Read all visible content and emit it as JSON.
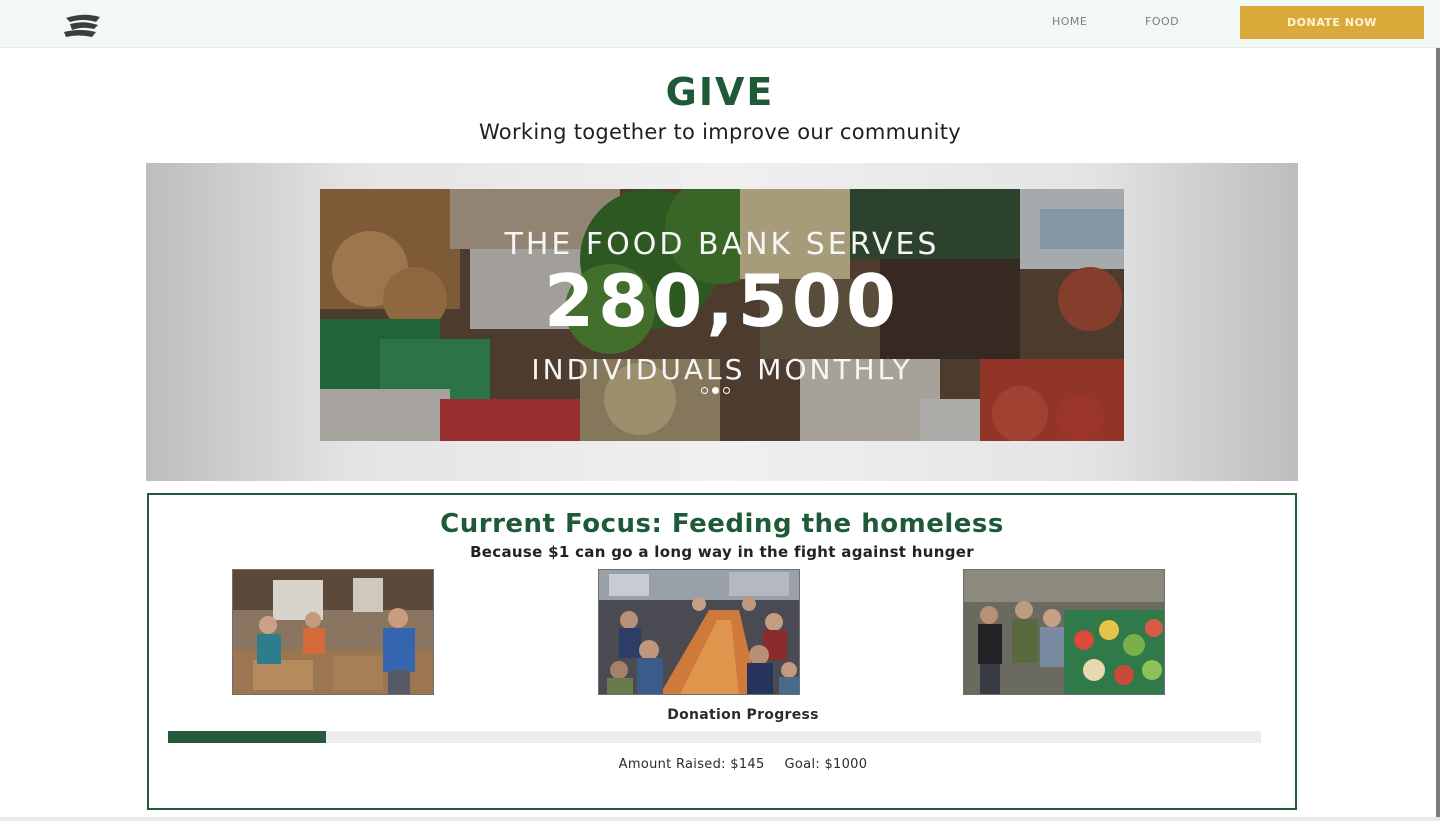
{
  "nav": {
    "logo_icon": "swirl-logo-icon",
    "links": [
      "HOME",
      "FOOD"
    ],
    "donate_label": "DONATE NOW"
  },
  "header": {
    "title": "GIVE",
    "subtitle": "Working together to improve our community"
  },
  "carousel": {
    "line1": "THE FOOD BANK SERVES",
    "number": "280,500",
    "line3": "INDIVIDUALS MONTHLY",
    "slide_count": 3,
    "active_slide": 1
  },
  "focus": {
    "title": "Current Focus: Feeding the homeless",
    "subtitle": "Because $1 can go a long way in the fight against hunger",
    "photos": [
      "volunteers-food-drive-photo",
      "community-meal-photo",
      "produce-distribution-photo"
    ],
    "progress_label": "Donation Progress",
    "raised_text": "Amount Raised: $145",
    "goal_text": "Goal: $1000",
    "raised": 145,
    "goal": 1000,
    "progress_fraction": 0.145
  },
  "colors": {
    "brand_green": "#1e5a37",
    "donate_gold": "#d9aa3a",
    "nav_bg": "#f2f8f3"
  }
}
